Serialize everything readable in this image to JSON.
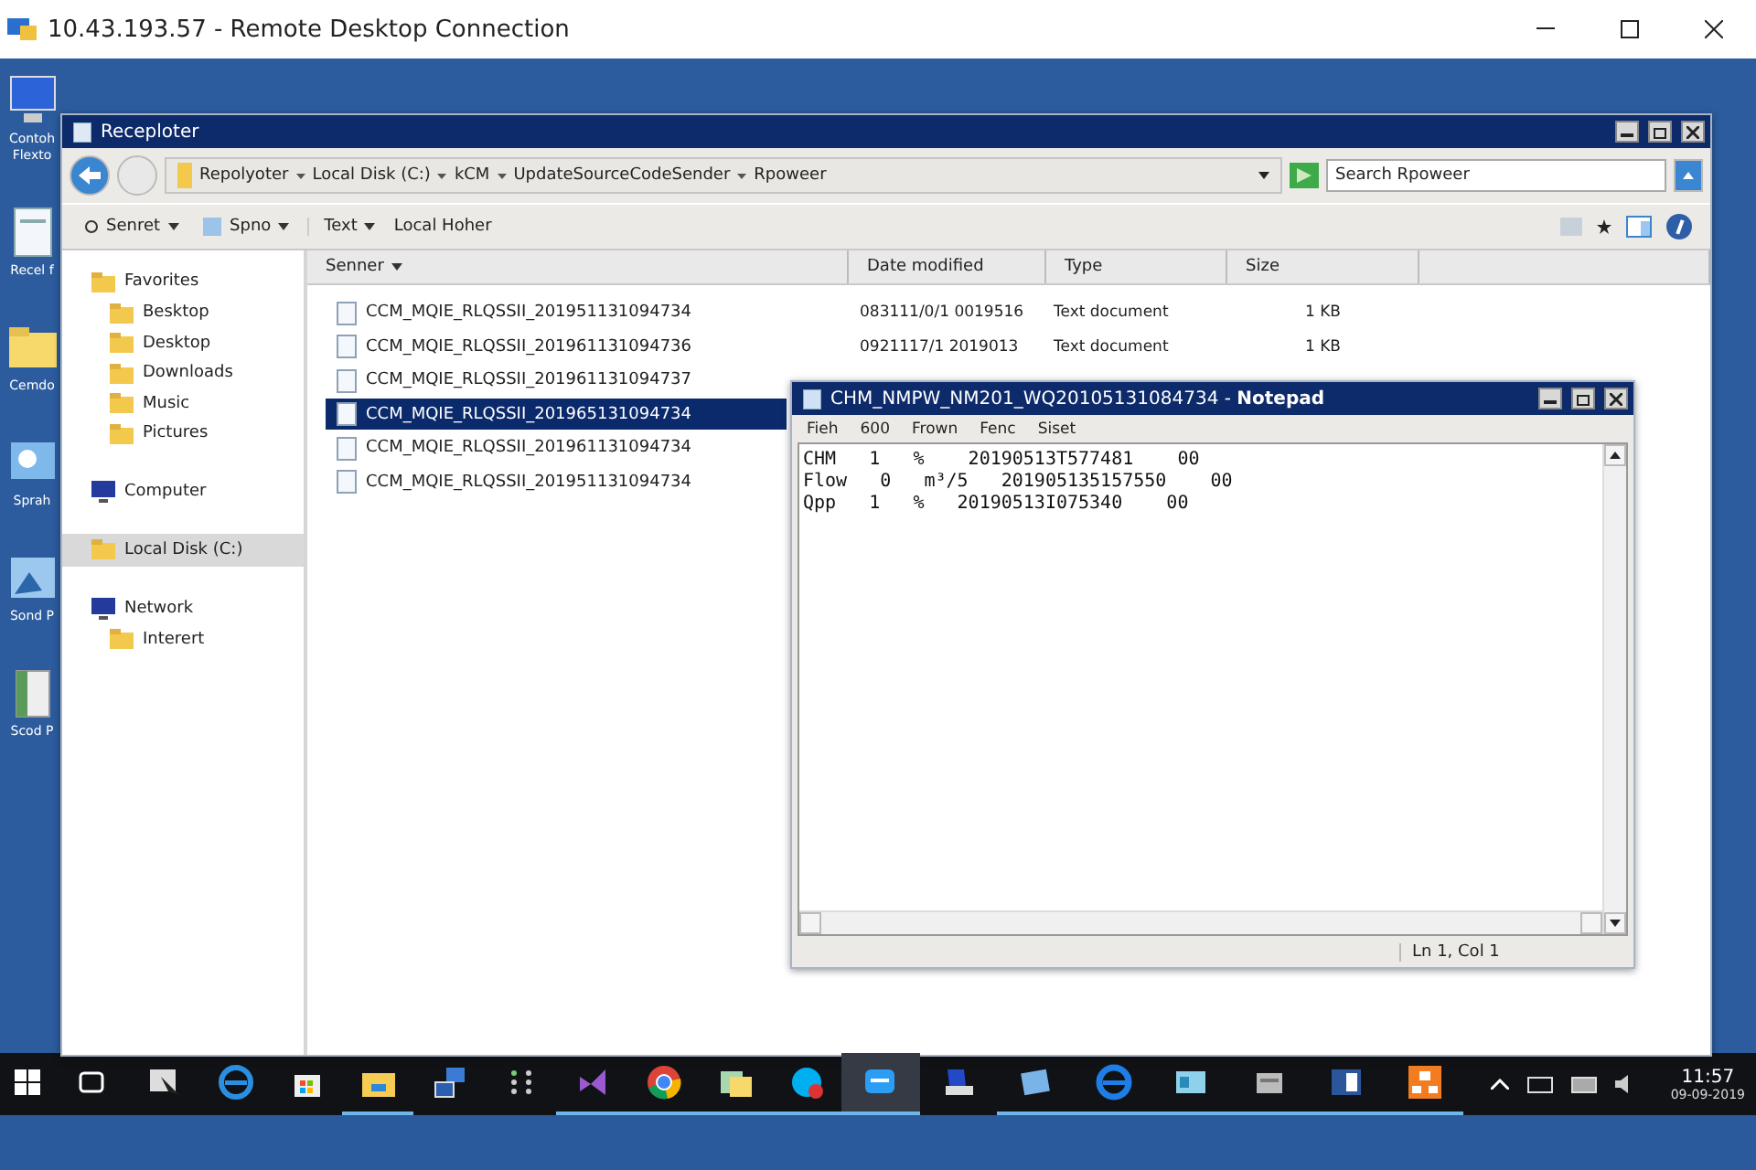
{
  "window": {
    "title": "10.43.193.57 - Remote Desktop Connection"
  },
  "desktop_icons": [
    {
      "label": "Contoh Flexto"
    },
    {
      "label": "Recel f"
    },
    {
      "label": "Cemdo"
    },
    {
      "label": "Sprah"
    },
    {
      "label": "Sond P"
    },
    {
      "label": "Scod P"
    }
  ],
  "explorer": {
    "title": "Receploter",
    "breadcrumb": [
      "Repolyoter",
      "Local Disk (C:)",
      "kCM",
      "UpdateSourceCodeSender",
      "Rpoweer"
    ],
    "search": {
      "placeholder": "Search Rpoweer"
    },
    "toolbar": [
      {
        "label": "Senret",
        "kind": "menu"
      },
      {
        "label": "Spno",
        "kind": "menu"
      },
      {
        "label": "Text",
        "kind": "text-menu"
      },
      {
        "label": "Local Hoher",
        "kind": "text"
      }
    ],
    "sidebar": [
      {
        "label": "Favorites",
        "selected": false,
        "children": [
          {
            "label": "Besktop",
            "selected": false
          },
          {
            "label": "Desktop",
            "selected": false
          },
          {
            "label": "Downloads",
            "selected": false
          },
          {
            "label": "Music",
            "selected": false
          },
          {
            "label": "Pictures",
            "selected": false
          }
        ]
      },
      {
        "label": "Computer",
        "selected": false
      },
      {
        "label": "Local Disk (C:)",
        "selected": true
      },
      {
        "label": "Network",
        "selected": false,
        "children": [
          {
            "label": "Interert",
            "selected": false
          }
        ]
      }
    ],
    "columns": [
      "Senner",
      "Date modified",
      "Type",
      "Size"
    ],
    "rows": [
      {
        "name": "CCM_MQIE_RLQSSII_201951131094734",
        "date": "083111/0/1 0019516",
        "type": "Text document",
        "size": "1 KB",
        "selected": false
      },
      {
        "name": "CCM_MQIE_RLQSSII_201961131094736",
        "date": "0921117/1 2019013",
        "type": "Text document",
        "size": "1 KB",
        "selected": false
      },
      {
        "name": "CCM_MQIE_RLQSSII_201961131094737",
        "selected": false
      },
      {
        "name": "CCM_MQIE_RLQSSII_201965131094734",
        "selected": true
      },
      {
        "name": "CCM_MQIE_RLQSSII_201961131094734",
        "selected": false
      },
      {
        "name": "CCM_MQIE_RLQSSII_201951131094734",
        "selected": false
      }
    ]
  },
  "notepad": {
    "title": "CHM_NMPW_NM201_WQ20105131084734 - **Notepad**",
    "menu": [
      "Fieh",
      "600",
      "Frown",
      "Fenc",
      "Siset"
    ],
    "lines": [
      "CHM   1   %    20190513T577481    00",
      "Flow   0   m³/5   201905135157550    00",
      "Qpp   1   %   20190513I075340    00"
    ],
    "status": "Ln 1, Col 1"
  },
  "taskbar": {
    "apps": [
      {
        "running": false,
        "selected": false
      },
      {
        "running": false,
        "selected": false
      },
      {
        "running": false,
        "selected": false
      },
      {
        "running": true,
        "selected": false
      },
      {
        "running": false,
        "selected": false
      },
      {
        "running": false,
        "selected": false
      },
      {
        "running": true,
        "selected": false
      },
      {
        "running": true,
        "selected": false
      },
      {
        "running": true,
        "selected": false
      },
      {
        "running": true,
        "selected": false
      },
      {
        "running": true,
        "selected": true
      },
      {
        "running": false,
        "selected": false
      },
      {
        "running": true,
        "selected": false
      },
      {
        "running": true,
        "selected": false
      },
      {
        "running": true,
        "selected": false
      },
      {
        "running": true,
        "selected": false
      },
      {
        "running": true,
        "selected": false
      },
      {
        "running": true,
        "selected": false
      }
    ],
    "time": "11:57",
    "date": "09-09-2019"
  }
}
